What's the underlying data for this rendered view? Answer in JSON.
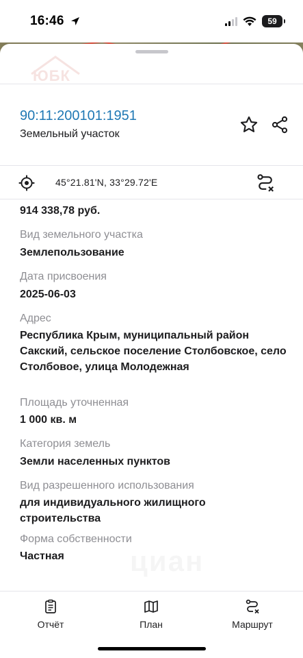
{
  "status_bar": {
    "time": "16:46",
    "battery": "59",
    "accent": "#000000"
  },
  "map": {
    "line_color": "#e24b3b"
  },
  "sheet": {
    "logo_text": "ЮБК",
    "cadastral_number": "90:11:200101:1951",
    "object_type": "Земельный участок",
    "coordinates": "45°21.81'N, 33°29.72'E",
    "link_color": "#1f78b4"
  },
  "fields": [
    {
      "label": "",
      "value": "914 338,78 руб."
    },
    {
      "label": "Вид земельного участка",
      "value": "Землепользование"
    },
    {
      "label": "Дата присвоения",
      "value": "2025-06-03"
    },
    {
      "label": "Адрес",
      "value": "Республика Крым, муниципальный район Сакский, сельское поселение Столбовское, село Столбовое, улица Молодежная"
    },
    {
      "label": "Площадь уточненная",
      "value": "1 000 кв. м"
    },
    {
      "label": "Категория земель",
      "value": "Земли населенных пунктов"
    },
    {
      "label": "Вид разрешенного использования",
      "value": "для индивидуального жилищного строительства"
    },
    {
      "label": "Форма собственности",
      "value": "Частная"
    }
  ],
  "watermark": "циан",
  "tabs": [
    {
      "label": "Отчёт",
      "icon": "report-icon"
    },
    {
      "label": "План",
      "icon": "map-icon"
    },
    {
      "label": "Маршрут",
      "icon": "route-icon"
    }
  ]
}
